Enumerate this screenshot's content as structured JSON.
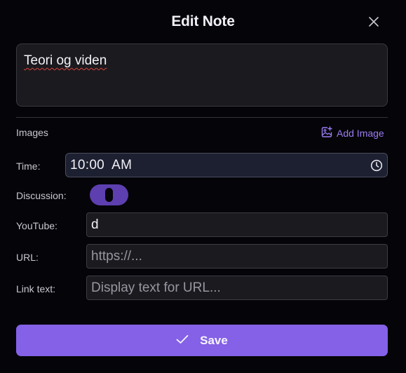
{
  "dialog": {
    "title": "Edit Note"
  },
  "note": {
    "text": "Teori og viden"
  },
  "images": {
    "label": "Images",
    "add_label": "Add Image"
  },
  "time": {
    "label": "Time:",
    "value": "10:00  AM"
  },
  "discussion": {
    "label": "Discussion:",
    "enabled": true
  },
  "youtube": {
    "label": "YouTube:",
    "value": "d"
  },
  "url": {
    "label": "URL:",
    "placeholder": "https://..."
  },
  "link_text": {
    "label": "Link text:",
    "placeholder": "Display text for URL..."
  },
  "save": {
    "label": "Save"
  },
  "colors": {
    "background": "#050409",
    "accent": "#8461e6",
    "toggle_on": "#5d3fb0",
    "link": "#9a7cf0"
  },
  "icons": [
    "close-icon",
    "add-image-icon",
    "clock-icon",
    "check-icon"
  ]
}
